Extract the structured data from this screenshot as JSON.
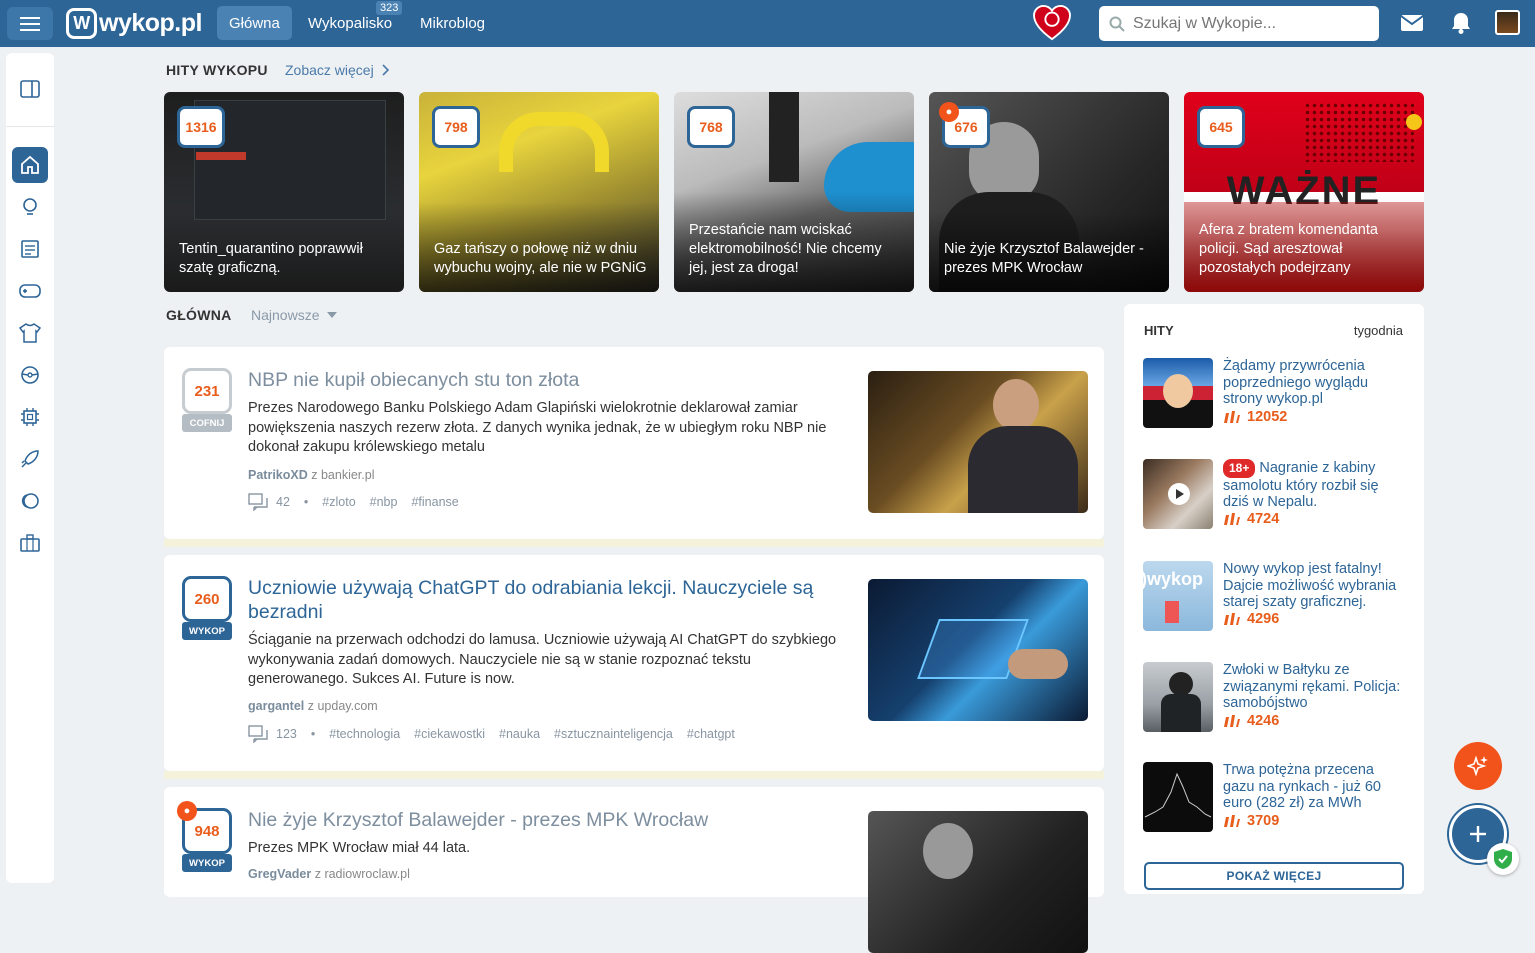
{
  "topbar": {
    "logo_text": "wykop.pl",
    "tabs": [
      {
        "label": "Główna",
        "active": true
      },
      {
        "label": "Wykopalisko",
        "badge": "323"
      },
      {
        "label": "Mikroblog"
      }
    ],
    "search_placeholder": "Szukaj w Wykopie..."
  },
  "hits_section": {
    "title": "HITY WYKOPU",
    "see_more": "Zobacz więcej",
    "items": [
      {
        "votes": "1316",
        "title": "Tentin_quarantino poprawwił szatę graficzną."
      },
      {
        "votes": "798",
        "title": "Gaz tańszy o połowę niż w dniu wybuchu wojny, ale nie w PGNiG"
      },
      {
        "votes": "768",
        "title": "Przestańcie nam wciskać elektromobilność! Nie chcemy jej, jest za droga!"
      },
      {
        "votes": "676",
        "title": "Nie żyje Krzysztof Balawejder - prezes MPK Wrocław",
        "hot": true
      },
      {
        "votes": "645",
        "title": "Afera z bratem komendanta policji. Sąd aresztował pozostałych podejrzany",
        "image_text": "WAŻNE"
      }
    ]
  },
  "main": {
    "title": "GŁÓWNA",
    "sort": "Najnowsze",
    "links": [
      {
        "votes": "231",
        "tag": "COFNIJ",
        "title": "NBP nie kupił obiecanych stu ton złota",
        "desc": "Prezes Narodowego Banku Polskiego Adam Glapiński wielokrotnie deklarował zamiar powiększenia naszych rezerw złota. Z danych wynika jednak, że w ubiegłym roku NBP nie dokonał zakupu królewskiego metalu",
        "author": "PatrikoXD",
        "source": "z bankier.pl",
        "comments": "42",
        "tags": [
          "#zloto",
          "#nbp",
          "#finanse"
        ]
      },
      {
        "votes": "260",
        "tag": "WYKOP",
        "title": "Uczniowie używają ChatGPT do odrabiania lekcji. Nauczyciele są bezradni",
        "desc": "Ściąganie na przerwach odchodzi do lamusa. Uczniowie używają AI ChatGPT do szybkiego wykonywania zadań domowych. Nauczyciele nie są w stanie rozpoznać tekstu generowanego. Sukces AI. Future is now.",
        "author": "gargantel",
        "source": "z upday.com",
        "comments": "123",
        "tags": [
          "#technologia",
          "#ciekawostki",
          "#nauka",
          "#sztucznainteligencja",
          "#chatgpt"
        ]
      },
      {
        "votes": "948",
        "tag": "WYKOP",
        "title": "Nie żyje Krzysztof Balawejder - prezes MPK Wrocław",
        "desc": "Prezes MPK Wrocław miał 44 lata.",
        "author": "GregVader",
        "source": "z radiowroclaw.pl",
        "hot": true
      }
    ]
  },
  "right": {
    "title": "HITY",
    "period": "tygodnia",
    "items": [
      {
        "title": "Żądamy przywrócenia poprzedniego wyglądu strony wykop.pl",
        "score": "12052"
      },
      {
        "age": "18+",
        "title": "Nagranie z kabiny samolotu który rozbił się dziś w Nepalu.",
        "score": "4724"
      },
      {
        "title": "Nowy wykop jest fatalny! Dajcie możliwość wybrania starej szaty graficznej.",
        "score": "4296",
        "thumb_text": ")wykop"
      },
      {
        "title": "Zwłoki w Bałtyku ze związanymi rękami. Policja: samobójstwo",
        "score": "4246"
      },
      {
        "title": "Trwa potężna przecena gazu na rynkach - już 60 euro (282 zł) za MWh",
        "score": "3709"
      }
    ],
    "more_label": "POKAŻ WIĘCEJ"
  },
  "colors": {
    "brand": "#2d6597",
    "accent": "#e85d1c"
  }
}
